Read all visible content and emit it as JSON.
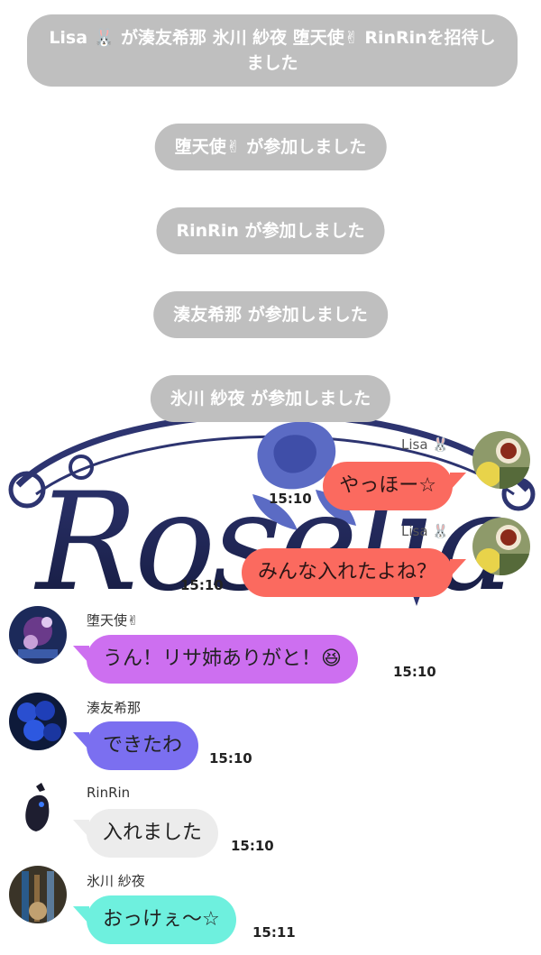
{
  "notices": [
    "Lisa 🐰 が湊友希那 氷川 紗夜 堕天使✌ RinRinを招待しました",
    "堕天使✌ が参加しました",
    "RinRin が参加しました",
    "湊友希那 が参加しました",
    "氷川 紗夜 が参加しました"
  ],
  "background_logo": {
    "text": "Roselia"
  },
  "messages": [
    {
      "sender": "Lisa 🐰",
      "text": "やっほー☆",
      "time": "15:10",
      "direction": "out",
      "bubble_color": "#fb6a5f"
    },
    {
      "sender": "Lisa 🐰",
      "text": "みんな入れたよね？",
      "time": "15:10",
      "direction": "out",
      "bubble_color": "#fb6a5f"
    },
    {
      "sender": "堕天使✌",
      "text": "うん！リサ姉ありがと！😆",
      "time": "15:10",
      "direction": "in",
      "bubble_color": "#cd6ff0"
    },
    {
      "sender": "湊友希那",
      "text": "できたわ",
      "time": "15:10",
      "direction": "in",
      "bubble_color": "#7b6ff0"
    },
    {
      "sender": "RinRin",
      "text": "入れました",
      "time": "15:10",
      "direction": "in",
      "bubble_color": "#ececec"
    },
    {
      "sender": "氷川 紗夜",
      "text": "おっけぇ〜☆",
      "time": "15:11",
      "direction": "in",
      "bubble_color": "#6ef0de"
    }
  ]
}
